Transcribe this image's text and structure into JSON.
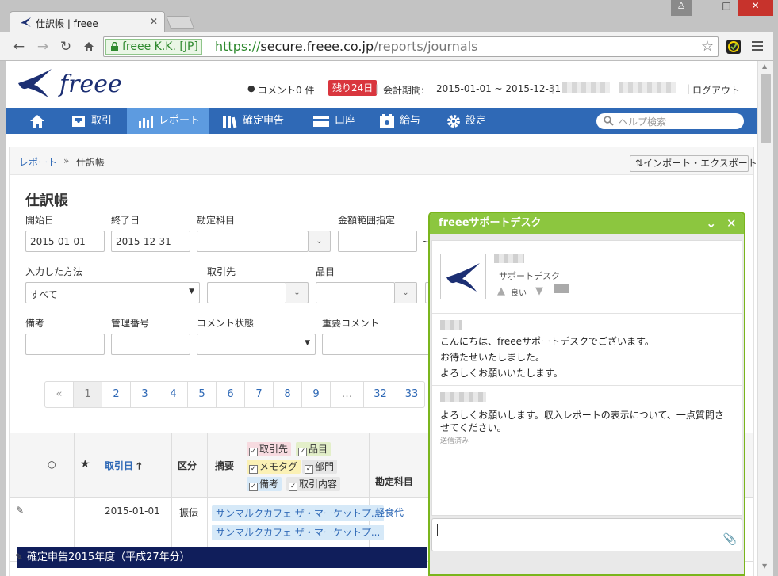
{
  "browser": {
    "tab_title": "仕訳帳 | freee",
    "ev_label": "freee K.K. [JP]",
    "url_scheme": "https://",
    "url_host": "secure.freee.co.jp",
    "url_path": "/reports/journals"
  },
  "header": {
    "logo_text": "freee",
    "comments_label": "コメント",
    "comments_count": "0 件",
    "remaining_badge": "残り24日",
    "period_label": "会計期間:",
    "period_value": "2015-01-01 ~ 2015-12-31",
    "logout": "ログアウト"
  },
  "nav": {
    "items": [
      {
        "label": "取引"
      },
      {
        "label": "レポート"
      },
      {
        "label": "確定申告"
      },
      {
        "label": "口座"
      },
      {
        "label": "給与"
      },
      {
        "label": "設定"
      }
    ],
    "help_placeholder": "ヘルプ検索"
  },
  "breadcrumb": {
    "root": "レポート",
    "sep": "»",
    "current": "仕訳帳",
    "import_export": "インポート・エクスポート"
  },
  "page_title": "仕訳帳",
  "filters": {
    "start_label": "開始日",
    "start_value": "2015-01-01",
    "end_label": "終了日",
    "end_value": "2015-12-31",
    "account_label": "勘定科目",
    "amount_label": "金額範囲指定",
    "method_label": "入力した方法",
    "method_value": "すべて",
    "partner_label": "取引先",
    "item_label": "品目",
    "note_label": "備考",
    "mgmt_label": "管理番号",
    "comment_status_label": "コメント状態",
    "important_comment_label": "重要コメント"
  },
  "pager": {
    "prev": "«",
    "pages": [
      "1",
      "2",
      "3",
      "4",
      "5",
      "6",
      "7",
      "8",
      "9",
      "…",
      "32",
      "33"
    ]
  },
  "table": {
    "col_date": "取引日",
    "col_kubun": "区分",
    "col_summary": "摘要",
    "col_account": "勘定科目",
    "summary_checks": [
      {
        "label": "取引先",
        "bg": "#f7dbe0"
      },
      {
        "label": "品目",
        "bg": "#e3efc9"
      },
      {
        "label": "メモタグ",
        "bg": "#fbf1b5"
      },
      {
        "label": "部門",
        "bg": "#e6e6e6"
      },
      {
        "label": "備考",
        "bg": "#d6e9f8"
      },
      {
        "label": "取引内容",
        "bg": "#e6e6e6"
      }
    ],
    "rows": [
      {
        "date": "2015-01-01",
        "kubun": "振伝",
        "tags": [
          "サンマルクカフェ ザ・マーケットプ...",
          "サンマルクカフェ ザ・マーケットプ..."
        ],
        "account": "軽食代"
      }
    ]
  },
  "bottom_bar": {
    "text": "確定申告2015年度（平成27年分）"
  },
  "chat": {
    "title": "freeeサポートデスク",
    "agent_role": "サポートデスク",
    "like_label": "良い",
    "msg1_lines": [
      "こんにちは、freeeサポートデスクでございます。",
      "お待たせいたしました。",
      "よろしくお願いいたします。"
    ],
    "msg2_lines": [
      "よろしくお願いします。収入レポートの表示について、一点質問さ",
      "せてください。"
    ],
    "msg2_status": "送信済み"
  },
  "colors": {
    "nav_blue": "#2f69b6",
    "nav_active": "#5d9be0",
    "chat_green": "#8cc63f",
    "badge_red": "#d9363e",
    "bottom_navy": "#101e5b"
  }
}
